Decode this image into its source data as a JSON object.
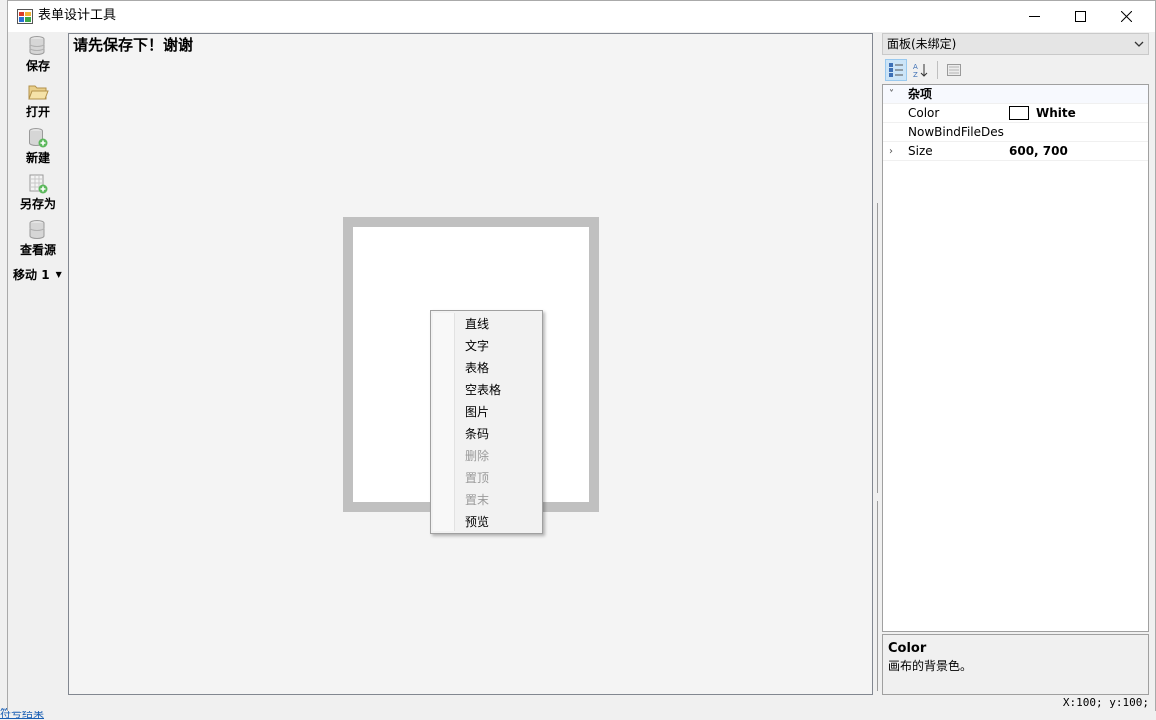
{
  "window": {
    "title": "表单设计工具"
  },
  "toolbar": {
    "save": "保存",
    "open": "打开",
    "new": "新建",
    "save_as": "另存为",
    "view_source": "查看源",
    "move_label": "移动",
    "move_value": "1"
  },
  "canvas": {
    "notice": "请先保存下！谢谢"
  },
  "context_menu": {
    "items": [
      {
        "label": "直线",
        "enabled": true
      },
      {
        "label": "文字",
        "enabled": true
      },
      {
        "label": "表格",
        "enabled": true
      },
      {
        "label": "空表格",
        "enabled": true
      },
      {
        "label": "图片",
        "enabled": true
      },
      {
        "label": "条码",
        "enabled": true
      },
      {
        "label": "删除",
        "enabled": false
      },
      {
        "label": "置顶",
        "enabled": false
      },
      {
        "label": "置末",
        "enabled": false
      },
      {
        "label": "预览",
        "enabled": true
      }
    ]
  },
  "property_panel": {
    "object_selector": "面板(未绑定)",
    "category": "杂项",
    "rows": [
      {
        "name": "Color",
        "value": "White",
        "swatch_color": "#ffffff"
      },
      {
        "name": "NowBindFileDesc",
        "value": ""
      },
      {
        "name": "Size",
        "value": "600, 700"
      }
    ],
    "description": {
      "title": "Color",
      "text": "画布的背景色。"
    }
  },
  "status": {
    "coords": "X:100; y:100;"
  },
  "background": {
    "link_text": "符号结果"
  },
  "colors": {
    "canvas_bg": "#f4f4f4",
    "frame": "#c0c0c0",
    "paper": "#ffffff",
    "disabled_text": "#9a9a9a",
    "selected_tool": "#cce4f7"
  }
}
